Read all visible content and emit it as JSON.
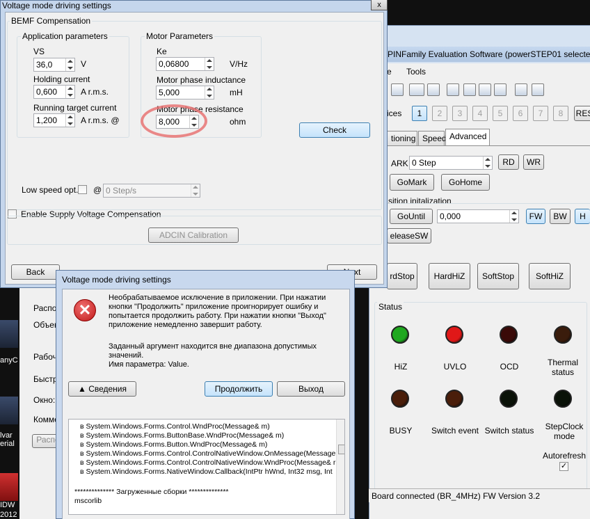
{
  "vm_window": {
    "title": "Voltage mode driving settings",
    "close": "x",
    "groupbox_title": "BEMF Compensation",
    "app_params": {
      "title": "Application parameters",
      "vs_label": "VS",
      "vs_value": "36,0",
      "vs_unit": "V",
      "hold_label": "Holding current",
      "hold_value": "0,600",
      "hold_unit": "A r.m.s.",
      "run_label": "Running target current",
      "run_value": "1,200",
      "run_unit": "A r.m.s.  @"
    },
    "motor_params": {
      "title": "Motor Parameters",
      "ke_label": "Ke",
      "ke_value": "0,06800",
      "ke_unit": "V/Hz",
      "ind_label": "Motor phase inductance",
      "ind_value": "5,000",
      "ind_unit": "mH",
      "res_label": "Motor phase resistance",
      "res_value": "8,000",
      "res_unit": "ohm"
    },
    "check_button": "Check",
    "low_speed_label": "Low speed opt.",
    "at": "@",
    "low_speed_value": "0 Step/s",
    "enable_supply": "Enable Supply Voltage Compensation",
    "adcin_button": "ADCIN Calibration",
    "back_button": "Back",
    "next_button": "Next"
  },
  "error_dialog": {
    "title": "Voltage mode driving settings",
    "message_1": "Необрабатываемое исключение в приложении. При нажатии кнопки \"Продолжить\" приложение проигнорирует ошибку и попытается продолжить работу. При нажатии кнопки \"Выход\" приложение немедленно завершит работу.",
    "message_2": "Заданный аргумент находится вне диапазона допустимых значений.",
    "message_3": "Имя параметра: Value.",
    "details_button": "Сведения",
    "continue_button": "Продолжить",
    "exit_button": "Выход",
    "trace": [
      "в System.Windows.Forms.Control.WndProc(Message& m)",
      "в System.Windows.Forms.ButtonBase.WndProc(Message& m)",
      "в System.Windows.Forms.Button.WndProc(Message& m)",
      "в System.Windows.Forms.Control.ControlNativeWindow.OnMessage(Message",
      "в System.Windows.Forms.Control.ControlNativeWindow.WndProc(Message& r",
      "в System.Windows.Forms.NativeWindow.Callback(IntPtr hWnd, Int32 msg, Int"
    ],
    "loaded_assemblies": "************** Загруженные сборки **************",
    "mscorlib": "mscorlib"
  },
  "eval_window": {
    "title": "PINFamily Evaluation Software (powerSTEP01 selected)",
    "menu_e": "e",
    "menu_tools": "Tools",
    "devices_label": "ices",
    "device_numbers": [
      "1",
      "2",
      "3",
      "4",
      "5",
      "6",
      "7",
      "8"
    ],
    "reset_button": "RES",
    "tabs": [
      "tioning",
      "Speed",
      "Advanced"
    ],
    "mark_label": "ARK",
    "mark_value": "0 Step",
    "rd_button": "RD",
    "wr_button": "WR",
    "gomark_button": "GoMark",
    "gohome_button": "GoHome",
    "position_init_label": "sition initalization",
    "gountil_button": "GoUntil",
    "gountil_value": "0,000",
    "fw_button": "FW",
    "bw_button": "BW",
    "h_button": "H",
    "releasesw_button": "eleaseSW",
    "hardstop_button": "rdStop",
    "hardhiz_button": "HardHiZ",
    "softstop_button": "SoftStop",
    "softhiz_button": "SoftHiZ",
    "status_title": "Status",
    "leds": [
      {
        "label": "HiZ",
        "color": "#1fa81f"
      },
      {
        "label": "UVLO",
        "color": "#e01818"
      },
      {
        "label": "OCD",
        "color": "#3a0a08"
      },
      {
        "label": "Thermal status",
        "color": "#3a1c0c"
      },
      {
        "label": "BUSY",
        "color": "#4a1e0a"
      },
      {
        "label": "Switch event",
        "color": "#4a1e0a"
      },
      {
        "label": "Switch status",
        "color": "#0a1208"
      },
      {
        "label": "StepClock mode",
        "color": "#0a1208"
      }
    ],
    "autorefresh_label": "Autorefresh",
    "autorefresh_check": "✓",
    "status_bar": "Board connected (BR_4MHz)  FW Version 3.2"
  },
  "desktop_texts": {
    "left_1": "Распо",
    "left_2": "Объек",
    "left_3": "Рабоч",
    "left_4": "Быстр",
    "left_5": "Окно:",
    "left_6": "Комме",
    "left_7": "Распо",
    "icon_1": "anyC",
    "icon_2": "lvar",
    "icon_3": "erial",
    "icon_4": "IDW",
    "icon_5": "2012"
  }
}
